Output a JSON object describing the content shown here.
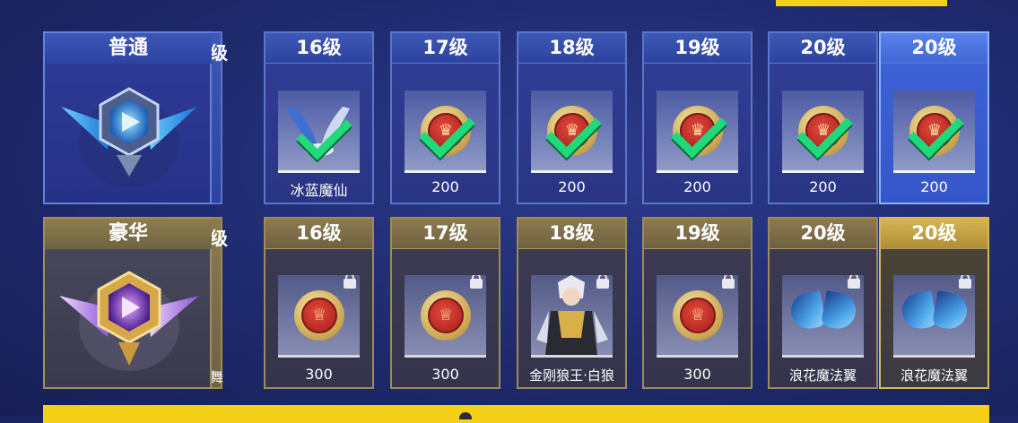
{
  "tiers": {
    "normal": {
      "label": "普通"
    },
    "deluxe": {
      "label": "豪华"
    }
  },
  "normal_row": [
    {
      "level": "16级",
      "reward": "冰蓝魔仙",
      "icon": "wing-emblem-icon",
      "claimed": true
    },
    {
      "level": "17级",
      "reward": "200",
      "icon": "coin-icon",
      "claimed": true
    },
    {
      "level": "18级",
      "reward": "200",
      "icon": "coin-icon",
      "claimed": true
    },
    {
      "level": "19级",
      "reward": "200",
      "icon": "coin-icon",
      "claimed": true
    },
    {
      "level": "20级",
      "reward": "200",
      "icon": "coin-icon",
      "claimed": true
    },
    {
      "level": "20级",
      "reward": "200",
      "icon": "coin-icon",
      "claimed": true
    }
  ],
  "deluxe_row": [
    {
      "level": "16级",
      "reward": "300",
      "icon": "trophy-coin-icon",
      "locked": true
    },
    {
      "level": "17级",
      "reward": "300",
      "icon": "trophy-coin-icon",
      "locked": true
    },
    {
      "level": "18级",
      "reward": "金刚狼王·白狼",
      "icon": "character-skin-icon",
      "locked": true
    },
    {
      "level": "19级",
      "reward": "300",
      "icon": "trophy-coin-icon",
      "locked": true
    },
    {
      "level": "20级",
      "reward": "浪花魔法翼",
      "icon": "wings-icon",
      "locked": true
    },
    {
      "level": "20级",
      "reward": "浪花魔法翼",
      "icon": "wings-icon",
      "locked": true
    }
  ],
  "peek": {
    "normal_level_tail": "级",
    "deluxe_level_tail": "级",
    "deluxe_reward_tail": "舞"
  },
  "colors": {
    "accent_yellow": "#f5d018",
    "check_green": "#1fd97a",
    "blue_card": "#2e43a0",
    "gold_card": "#8c7b4f"
  }
}
